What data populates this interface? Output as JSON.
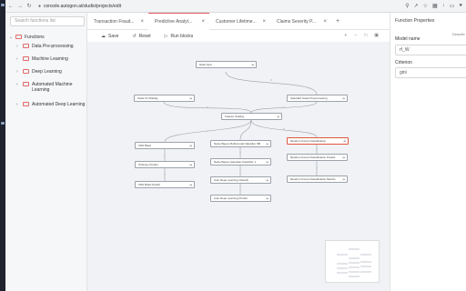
{
  "browser": {
    "url": "console.autogon.ai/studio/projects/edit"
  },
  "sidebar": {
    "search_placeholder": "Search functions list",
    "root_label": "Functions",
    "items": [
      {
        "label": "Data Pre-processing"
      },
      {
        "label": "Machine Learning"
      },
      {
        "label": "Deep Learning"
      },
      {
        "label": "Automated Machine Learning"
      },
      {
        "label": "Automated Deep Learning"
      }
    ]
  },
  "tabs": [
    {
      "label": "Transaction Fraud..."
    },
    {
      "label": "Predictive Analyt..."
    },
    {
      "label": "Customer Lifetime..."
    },
    {
      "label": "Claims Severity P..."
    }
  ],
  "toolbar": {
    "save": "Save",
    "reset": "Reset",
    "run": "Run blocks"
  },
  "nodes": [
    {
      "label": "Data Input"
    },
    {
      "label": "Scale Or Multiply"
    },
    {
      "label": "Standard Scale Preprocessing"
    },
    {
      "label": "Feature Scaling"
    },
    {
      "label": "KNN Blast"
    },
    {
      "label": "Naive Bayes Multinomial Classifier NB"
    },
    {
      "label": "Random Forest Classification"
    },
    {
      "label": "Ordinary Predict"
    },
    {
      "label": "Naive Bayes Gaussian Classifier 1"
    },
    {
      "label": "Random Forest Classification Predict"
    },
    {
      "label": "KNN Blast Predict"
    },
    {
      "label": "Auto Deep Learning Classify"
    },
    {
      "label": "Random Forest Classification Metrics"
    },
    {
      "label": "Auto Deep Learning Predict"
    }
  ],
  "props": {
    "title": "Function Properties",
    "describe": "Describ",
    "model_name_label": "Model name",
    "model_name_value": "rf_W",
    "criterion_label": "Criterion",
    "criterion_value": "gini"
  }
}
